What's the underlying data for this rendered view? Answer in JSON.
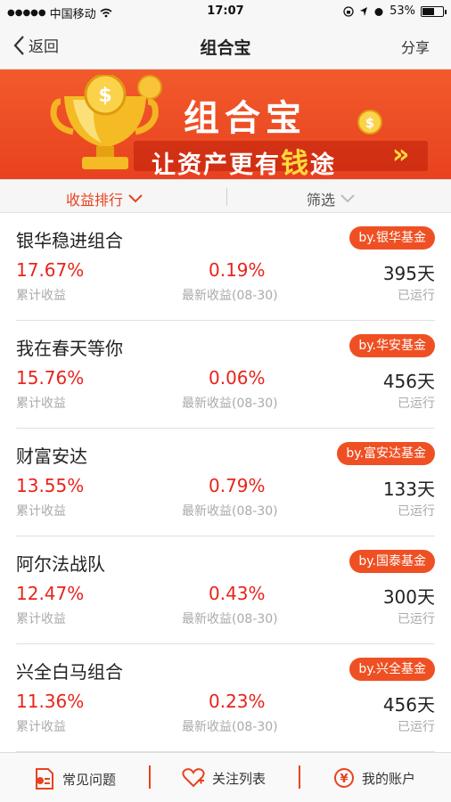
{
  "status_bar": {
    "carrier": "中国移动",
    "time": "17:07",
    "battery": "53%",
    "battery_level": 0.53
  },
  "nav": {
    "back_label": "返回",
    "title": "组合宝",
    "share_label": "分享"
  },
  "banner": {
    "title": "组合宝",
    "slogan_pre": "让资产更有",
    "slogan_highlight": "钱",
    "slogan_post": "途",
    "arrows": "»"
  },
  "filters": {
    "sort_label": "收益排行",
    "screen_label": "筛选"
  },
  "labels": {
    "cumulative": "累计收益",
    "latest": "最新收益(08-30)",
    "running": "已运行"
  },
  "portfolios": [
    {
      "name": "银华稳进组合",
      "badge": "by.银华基金",
      "cumulative": "17.67%",
      "latest": "0.19%",
      "days": "395天"
    },
    {
      "name": "我在春天等你",
      "badge": "by.华安基金",
      "cumulative": "15.76%",
      "latest": "0.06%",
      "days": "456天"
    },
    {
      "name": "财富安达",
      "badge": "by.富安达基金",
      "cumulative": "13.55%",
      "latest": "0.79%",
      "days": "133天"
    },
    {
      "name": "阿尔法战队",
      "badge": "by.国泰基金",
      "cumulative": "12.47%",
      "latest": "0.43%",
      "days": "300天"
    },
    {
      "name": "兴全白马组合",
      "badge": "by.兴全基金",
      "cumulative": "11.36%",
      "latest": "0.23%",
      "days": "456天"
    }
  ],
  "tabs": {
    "faq": "常见问题",
    "watchlist": "关注列表",
    "account": "我的账户"
  },
  "colors": {
    "accent": "#e8421f",
    "gain": "#e8241c",
    "badge": "#ef5023"
  }
}
